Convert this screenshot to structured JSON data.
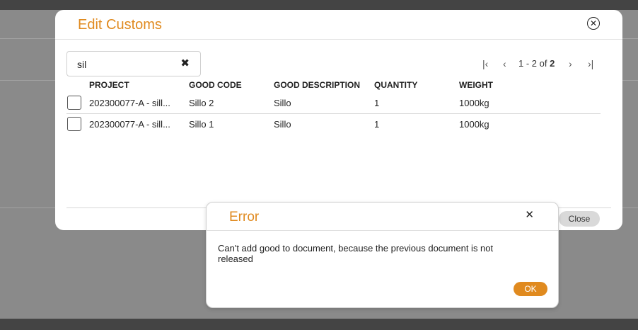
{
  "colors": {
    "accent": "#E08A1F",
    "overlay": "#8a8a8a",
    "bar": "#444444"
  },
  "edit_dialog": {
    "title": "Edit Customs",
    "close_icon": "close-circle-icon",
    "search": {
      "value": "sil",
      "clear_icon": "clear-x-icon"
    },
    "pagination": {
      "range": "1 - 2 of ",
      "total": "2",
      "icons": [
        "first-page-icon",
        "prev-page-icon",
        "next-page-icon",
        "last-page-icon"
      ]
    },
    "columns": [
      "PROJECT",
      "GOOD CODE",
      "GOOD DESCRIPTION",
      "QUANTITY",
      "WEIGHT"
    ],
    "rows": [
      {
        "project": "202300077-A - sill...",
        "good_code": "Sillo 2",
        "good_description": "Sillo",
        "quantity": "1",
        "weight": "1000kg"
      },
      {
        "project": "202300077-A - sill...",
        "good_code": "Sillo 1",
        "good_description": "Sillo",
        "quantity": "1",
        "weight": "1000kg"
      }
    ],
    "close_label": "Close"
  },
  "error_dialog": {
    "title": "Error",
    "close_icon": "close-x-icon",
    "message": "Can't add good to document, because the previous document is not released",
    "ok_label": "OK"
  }
}
